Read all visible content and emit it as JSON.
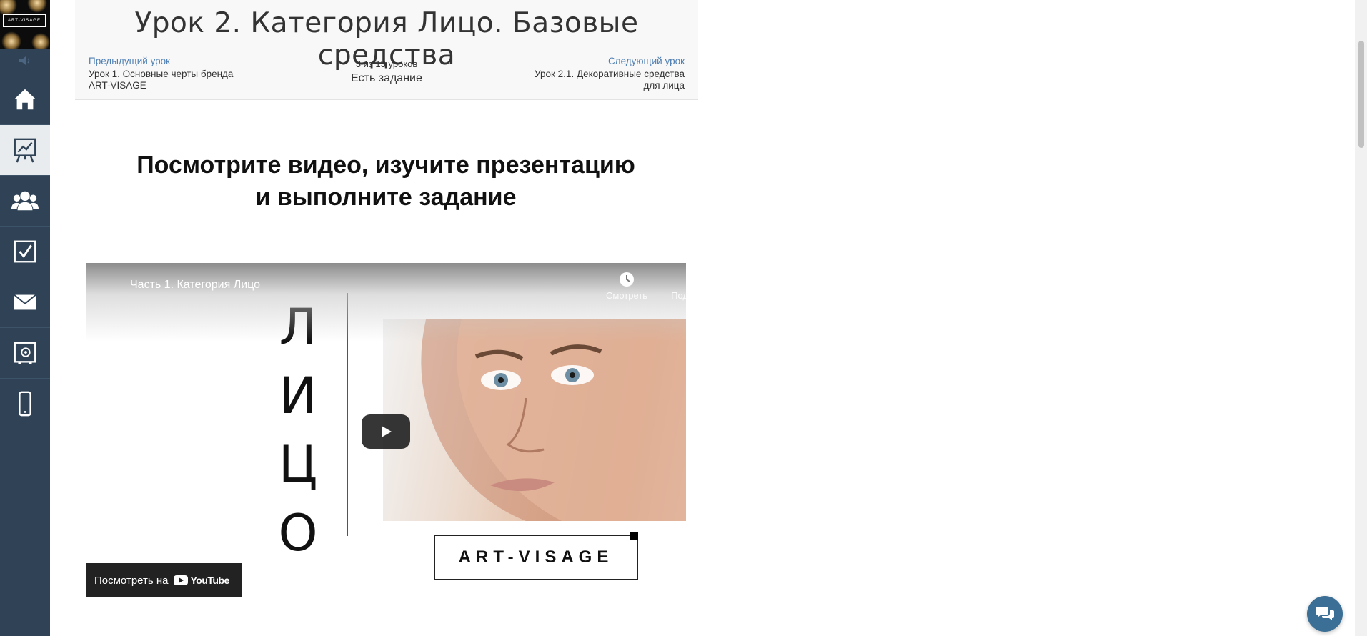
{
  "sidebar": {
    "logo_text": "ART-VISAGE",
    "items": [
      {
        "icon": "home-icon"
      },
      {
        "icon": "chart-board-icon"
      },
      {
        "icon": "users-icon"
      },
      {
        "icon": "checkbox-icon"
      },
      {
        "icon": "mail-icon"
      },
      {
        "icon": "safe-icon"
      },
      {
        "icon": "phone-icon"
      }
    ],
    "active_index": 1
  },
  "lesson": {
    "title": "Урок 2. Категория Лицо. Базовые средства",
    "prev_label": "Предыдущий урок",
    "prev_title": "Урок 1. Основные черты бренда ART-VISAGE",
    "next_label": "Следующий урок",
    "next_title": "Урок 2.1. Декоративные средства для лица",
    "counter": "3 из 13 уроков",
    "task_status": "Есть задание"
  },
  "main": {
    "headline": "Посмотрите видео, изучите презентацию и выполните задание"
  },
  "video": {
    "title": "Часть 1. Категория Лицо",
    "watch_later": "Смотреть",
    "share": "Поделиться",
    "letters": [
      "Л",
      "И",
      "Ц",
      "О"
    ],
    "brand": "ART-VISAGE",
    "watch_on": "Посмотреть на",
    "youtube": "YouTube"
  },
  "colors": {
    "sidebar": "#2f4256",
    "link": "#4f7fb2",
    "chat": "#3b6f95"
  }
}
